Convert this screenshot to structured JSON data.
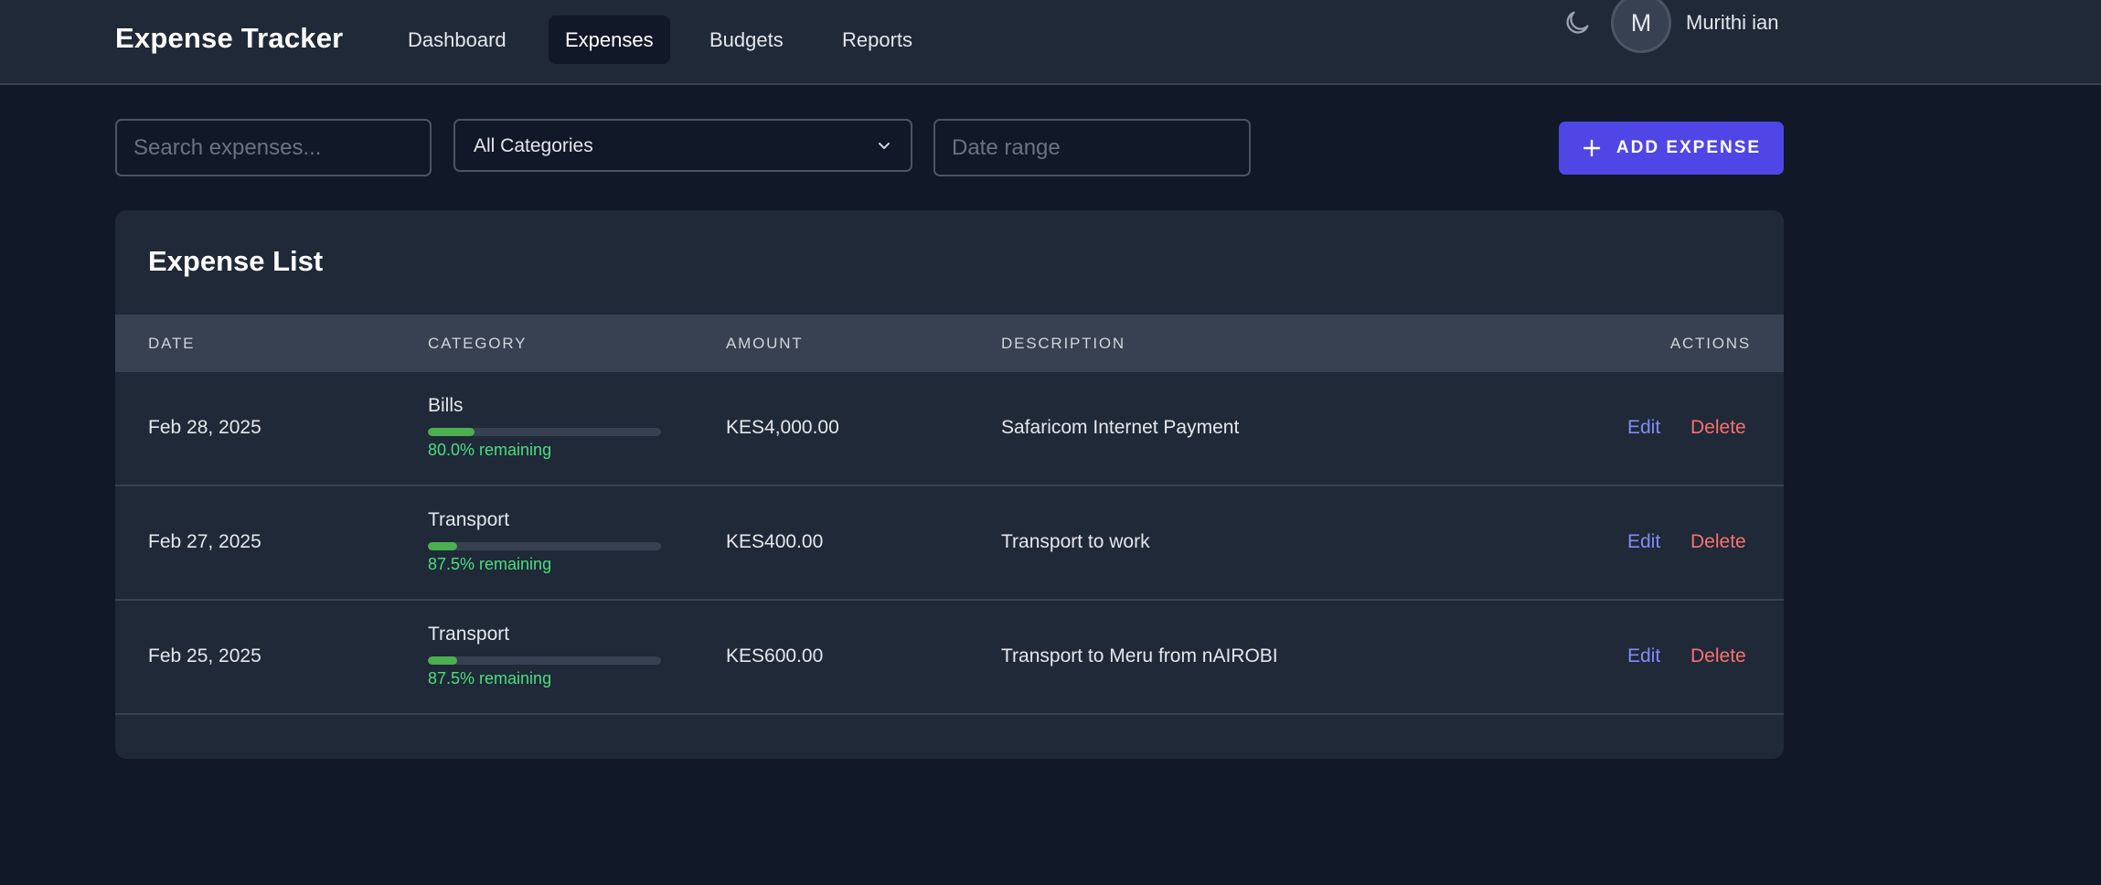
{
  "app": {
    "title": "Expense Tracker"
  },
  "nav": {
    "links": [
      {
        "label": "Dashboard",
        "active": false
      },
      {
        "label": "Expenses",
        "active": true
      },
      {
        "label": "Budgets",
        "active": false
      },
      {
        "label": "Reports",
        "active": false
      }
    ],
    "theme_icon": "moon-icon",
    "user": {
      "initial": "M",
      "name": "Murithi ian"
    }
  },
  "toolbar": {
    "search_placeholder": "Search expenses...",
    "category_select": {
      "value": "All Categories",
      "icon": "chevron-down-icon"
    },
    "date_placeholder": "Date range",
    "add_button": {
      "label": "ADD EXPENSE",
      "icon": "plus-icon"
    }
  },
  "expense_list": {
    "title": "Expense List",
    "columns": [
      "DATE",
      "CATEGORY",
      "AMOUNT",
      "DESCRIPTION",
      "ACTIONS"
    ],
    "rows": [
      {
        "date": "Feb 28, 2025",
        "category": "Bills",
        "spent_fraction": 0.2,
        "remaining_text": "80.0% remaining",
        "amount": "KES4,000.00",
        "description": "Safaricom Internet Payment",
        "edit_label": "Edit",
        "delete_label": "Delete"
      },
      {
        "date": "Feb 27, 2025",
        "category": "Transport",
        "spent_fraction": 0.125,
        "remaining_text": "87.5% remaining",
        "amount": "KES400.00",
        "description": "Transport to work",
        "edit_label": "Edit",
        "delete_label": "Delete"
      },
      {
        "date": "Feb 25, 2025",
        "category": "Transport",
        "spent_fraction": 0.125,
        "remaining_text": "87.5% remaining",
        "amount": "KES600.00",
        "description": "Transport to Meru from nAIROBI",
        "edit_label": "Edit",
        "delete_label": "Delete"
      }
    ]
  },
  "colors": {
    "background": "#111827",
    "surface": "#1f2937",
    "header_row": "#374151",
    "accent": "#4f46e5",
    "progress": "#4caf50",
    "remaining_text": "#4ade80",
    "edit": "#818cf8",
    "delete": "#f87171"
  }
}
